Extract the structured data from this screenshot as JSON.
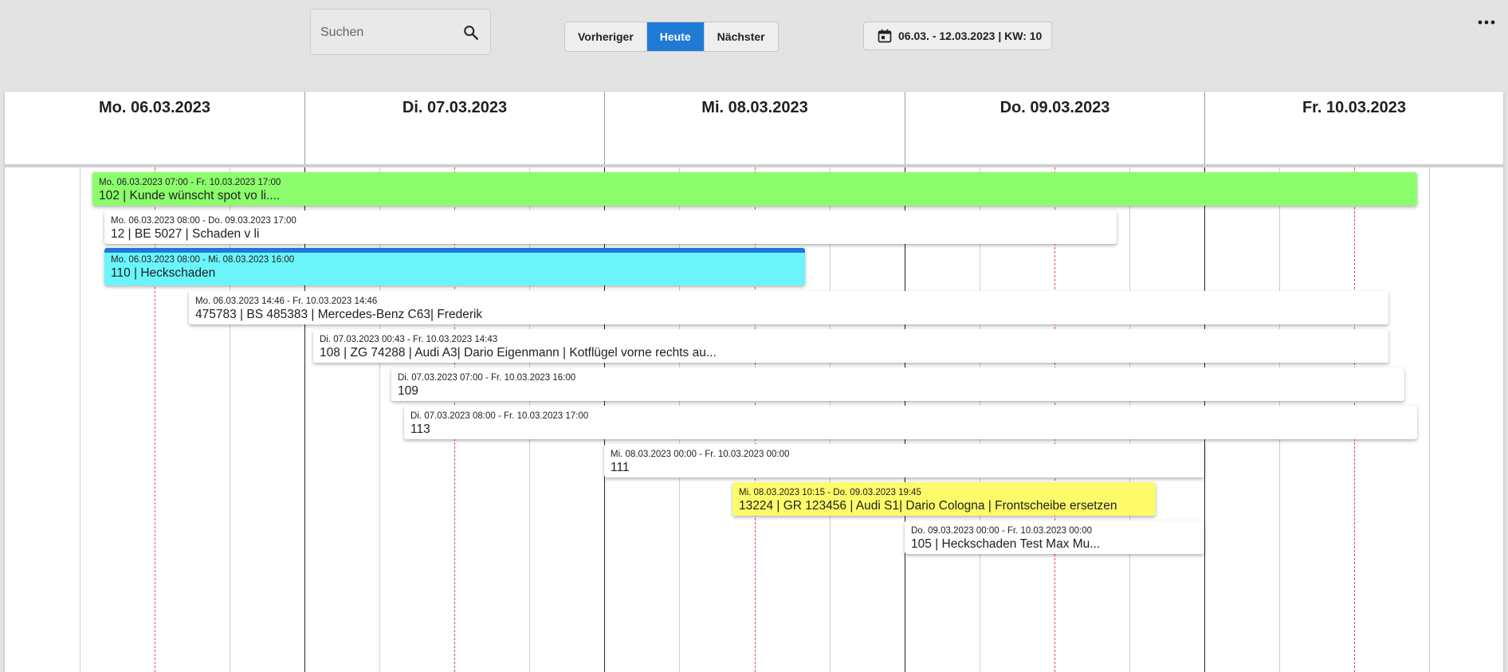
{
  "toolbar": {
    "search_placeholder": "Suchen",
    "prev_label": "Vorheriger",
    "today_label": "Heute",
    "next_label": "Nächster",
    "date_range": "06.03. - 12.03.2023 | KW: 10",
    "accent_color": "#1f7ad6"
  },
  "days": [
    {
      "label": "Mo. 06.03.2023"
    },
    {
      "label": "Di. 07.03.2023"
    },
    {
      "label": "Mi. 08.03.2023"
    },
    {
      "label": "Do. 09.03.2023"
    },
    {
      "label": "Fr. 10.03.2023"
    }
  ],
  "events": [
    {
      "time": "Mo. 06.03.2023 07:00 - Fr. 10.03.2023 17:00",
      "title": "102 | Kunde wünscht spot vo li....",
      "color": "#8cfd6c"
    },
    {
      "time": "Mo. 06.03.2023 08:00 - Do. 09.03.2023 17:00",
      "title": "12 | BE 5027 | Schaden v li",
      "color": "#ffffff"
    },
    {
      "time": "Mo. 06.03.2023 08:00 - Mi. 08.03.2023 16:00",
      "title": "110 | Heckschaden",
      "color": "#6af5fb"
    },
    {
      "time": "Mo. 06.03.2023 14:46 - Fr. 10.03.2023 14:46",
      "title": "475783 | BS 485383 | Mercedes-Benz C63| Frederik",
      "color": "#ffffff"
    },
    {
      "time": "Di. 07.03.2023 00:43 - Fr. 10.03.2023 14:43",
      "title": "108 | ZG 74288 | Audi A3| Dario Eigenmann | Kotflügel vorne rechts au...",
      "color": "#ffffff"
    },
    {
      "time": "Di. 07.03.2023 07:00 - Fr. 10.03.2023 16:00",
      "title": "109",
      "color": "#ffffff"
    },
    {
      "time": "Di. 07.03.2023 08:00 - Fr. 10.03.2023 17:00",
      "title": "113",
      "color": "#ffffff"
    },
    {
      "time": "Mi. 08.03.2023 00:00 - Fr. 10.03.2023 00:00",
      "title": "111",
      "color": "#ffffff"
    },
    {
      "time": "Mi. 08.03.2023 10:15 - Do. 09.03.2023 19:45",
      "title": "13224 | GR 123456 | Audi S1| Dario Cologna | Frontscheibe ersetzen",
      "color": "#fdfb6a"
    },
    {
      "time": "Do. 09.03.2023 00:00 - Fr. 10.03.2023 00:00",
      "title": "105 | Heckschaden Test Max Mu...",
      "color": "#ffffff"
    }
  ]
}
